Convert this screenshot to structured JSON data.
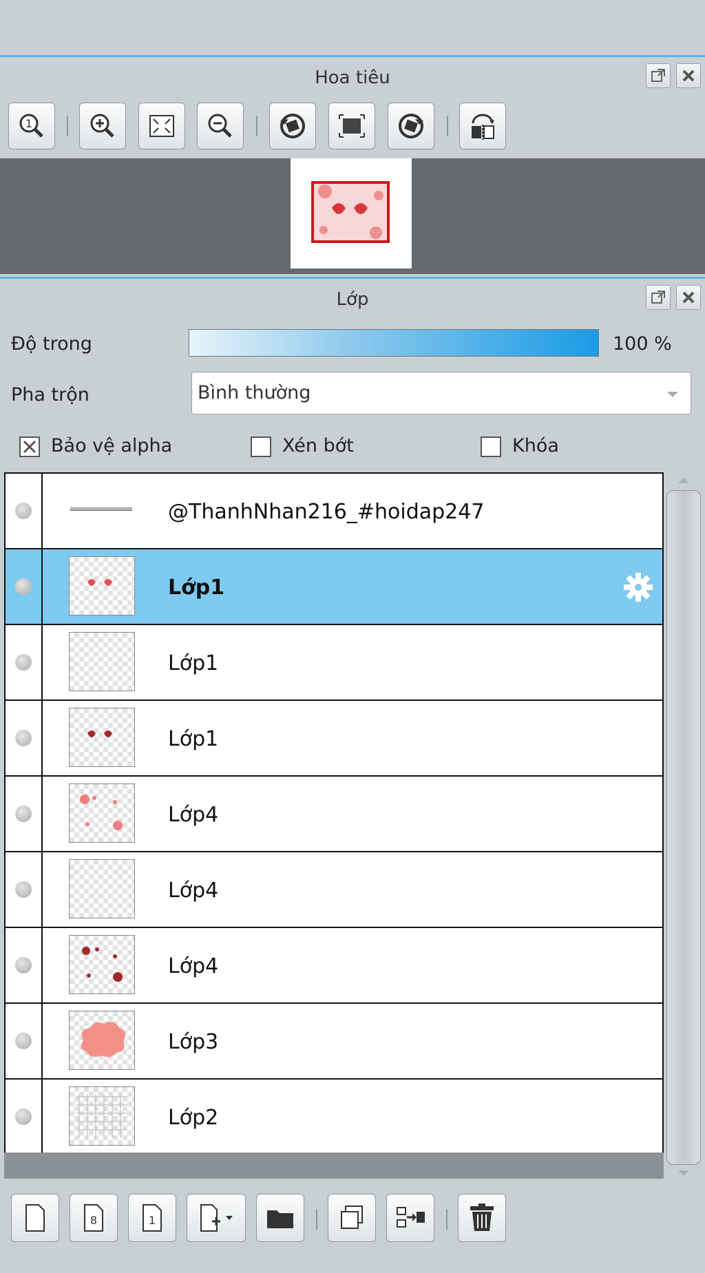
{
  "navigator": {
    "title": "Hoa tiêu",
    "toolbar": [
      {
        "icon": "zoom-actual-icon"
      },
      {
        "icon": "zoom-in-icon"
      },
      {
        "icon": "fit-screen-icon"
      },
      {
        "icon": "zoom-out-icon"
      },
      {
        "icon": "rotate-left-icon"
      },
      {
        "icon": "reset-view-icon"
      },
      {
        "icon": "rotate-right-icon"
      },
      {
        "icon": "flip-horizontal-icon"
      }
    ]
  },
  "layers_panel": {
    "title": "Lớp",
    "opacity": {
      "label": "Độ trong",
      "value": "100 %",
      "level": 1.0
    },
    "blend": {
      "label": "Pha trộn",
      "value": "Bình thường"
    },
    "options": {
      "protect_alpha": {
        "label": "Bảo vệ alpha",
        "checked": true
      },
      "clipping": {
        "label": "Xén bớt",
        "checked": false
      },
      "lock": {
        "label": "Khóa",
        "checked": false
      }
    },
    "layers": [
      {
        "name": "@ThanhNhan216_#hoidap247",
        "thumb": "text-line"
      },
      {
        "name": "Lớp1",
        "thumb": "red-hearts",
        "selected": true
      },
      {
        "name": "Lớp1",
        "thumb": "faint-white"
      },
      {
        "name": "Lớp1",
        "thumb": "dark-hearts"
      },
      {
        "name": "Lớp4",
        "thumb": "pink-dots"
      },
      {
        "name": "Lớp4",
        "thumb": "faint-white"
      },
      {
        "name": "Lớp4",
        "thumb": "dark-dots"
      },
      {
        "name": "Lớp3",
        "thumb": "pink-cloud"
      },
      {
        "name": "Lớp2",
        "thumb": "grid-pattern"
      }
    ],
    "bottom_toolbar": [
      {
        "icon": "new-layer-icon"
      },
      {
        "icon": "new-8bit-layer-icon"
      },
      {
        "icon": "new-1bit-layer-icon"
      },
      {
        "icon": "add-layer-menu-icon"
      },
      {
        "icon": "new-folder-icon"
      },
      {
        "icon": "duplicate-layer-icon"
      },
      {
        "icon": "merge-down-icon"
      },
      {
        "icon": "delete-layer-icon"
      }
    ]
  }
}
